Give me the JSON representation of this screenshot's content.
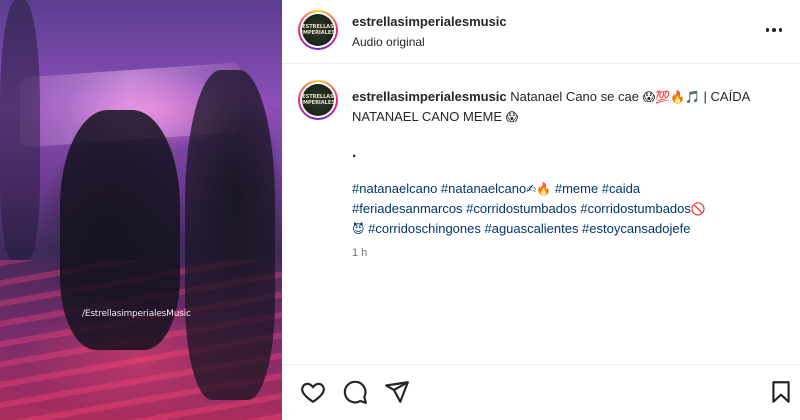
{
  "media": {
    "watermark": "/EstrellasimperialesMusic"
  },
  "post": {
    "username": "estrellasimperialesmusic",
    "audio": "Audio original",
    "avatar_text": "ESTRELLAS IMPERIALES"
  },
  "caption": {
    "username": "estrellasimperialesmusic",
    "text_line": "Natanael Cano se cae",
    "emojis_1": "😱💯🔥🎵",
    "text_line2": "| CAÍDA NATANAEL CANO MEME",
    "emoji_2": "😱",
    "dot": ".",
    "hashtags_1": "#natanaelcano #natanaelcano",
    "emoji_3": "✍🔥",
    "hashtags_1b": "#meme #caida",
    "hashtags_2": "#feriadesanmarcos #corridostumbados #corridostumbados",
    "emoji_4": "🚫",
    "emoji_5": "😈",
    "hashtags_3": "#corridoschingones #aguascalientes #estoycansadojefe",
    "time": "1 h"
  },
  "icons": {
    "more": "more-options-icon",
    "like": "heart-icon",
    "comment": "comment-icon",
    "share": "share-icon",
    "save": "bookmark-icon"
  }
}
